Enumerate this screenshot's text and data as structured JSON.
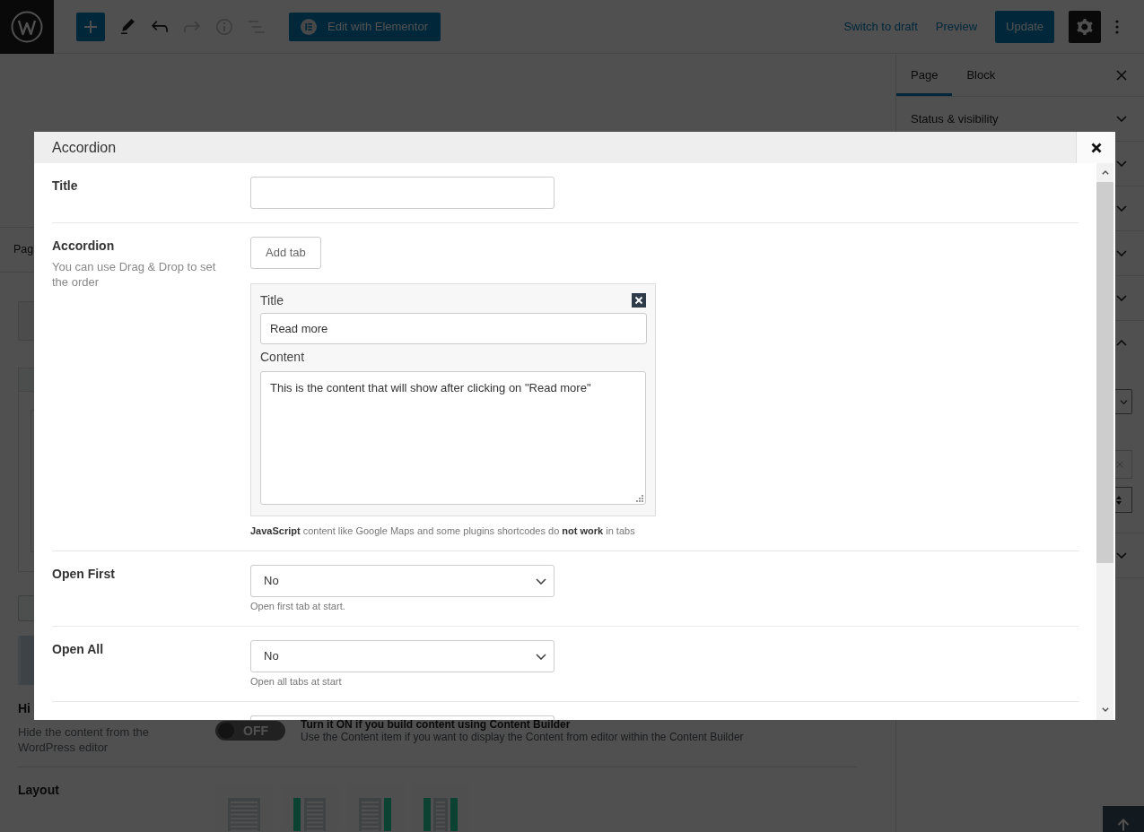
{
  "top_bar": {
    "tools": [
      {
        "kind": "add",
        "disabled": false
      },
      {
        "kind": "pencil",
        "disabled": false
      },
      {
        "kind": "undo",
        "disabled": false
      },
      {
        "kind": "redo",
        "disabled": true
      },
      {
        "kind": "info",
        "disabled": true
      },
      {
        "kind": "outline",
        "disabled": true
      }
    ],
    "builder_button": "Edit with Elementor",
    "links": [
      "Switch to draft",
      "Preview"
    ],
    "update_button": "Update",
    "settings": {
      "on": true
    }
  },
  "editor": {
    "tab_label": "Pag",
    "hide_setting": {
      "label": "Hi",
      "description": "Hide the content from the WordPress editor",
      "toggle": {
        "on": false,
        "label": "OFF"
      },
      "help_title": "Turn it ON if you build content using Content Builder",
      "help": "Use the Content item if you want to display the Content from editor within the Content Builder"
    },
    "layout_setting": {
      "label": "Layout",
      "options": [
        {
          "kind": "full"
        },
        {
          "kind": "left_sidebar"
        },
        {
          "kind": "right_sidebar"
        },
        {
          "kind": "both_sidebars"
        }
      ]
    }
  },
  "sidebar": {
    "tabs": [
      {
        "label": "Page",
        "selected": true
      },
      {
        "label": "Block",
        "selected": false
      }
    ],
    "panels": [
      {
        "title": "Status & visibility",
        "expanded": false
      },
      {
        "expanded": false
      },
      {
        "expanded": false
      },
      {
        "expanded": false
      },
      {
        "expanded": false
      },
      {
        "expanded": true
      },
      {
        "expanded": false
      }
    ]
  },
  "modal": {
    "title": "Accordion",
    "fields": [
      {
        "kind": "text",
        "label": "Title"
      },
      {
        "kind": "tabs",
        "label": "Accordion",
        "description": "You can use Drag & Drop to set the order",
        "add_button": "Add tab",
        "tabs": [
          {
            "title_label": "Title",
            "title": "Read more",
            "content_label": "Content",
            "content": "This is the content that will show after clicking on \"Read more\""
          }
        ],
        "note": "**JavaScript** content like Google Maps and some plugins shortcodes do **not work** in tabs"
      },
      {
        "kind": "select",
        "label": "Open First",
        "value": "No",
        "hint": "Open first tab at start."
      },
      {
        "kind": "select",
        "label": "Open All",
        "value": "No",
        "hint": "Open all tabs at start"
      },
      {
        "kind": "text"
      }
    ]
  }
}
